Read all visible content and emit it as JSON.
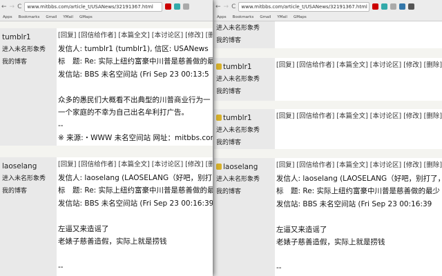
{
  "browser": {
    "url": "www.mitbbs.com/article_t/USANews/32191367.html",
    "bookmarks": [
      "Apps",
      "Bookmarks",
      "Gmail",
      "YMail",
      "GMaps"
    ]
  },
  "actions": "[回复] [回信给作者] [本篇全文] [本讨论区] [修改] [删除]",
  "side": {
    "show": "进入未名形象秀",
    "blog": "我的博客"
  },
  "post1": {
    "author": "tumblr1",
    "from": "发信人: tumblr1 (tumblr1), 信区: USANews",
    "title": "标　题: Re: 实际上纽约富豪中川普是慈善做的最少的",
    "station": "发信站: BBS 未名空间站 (Fri Sep 23 00:13:5",
    "line1": "众多的愚民们大概看不出典型的川普商业行为一",
    "line2": "一个家庭的不幸为自己出名牟利打广告。",
    "sig": "--",
    "source": "※ 来源:・WWW 未名空间站 网址：mitbbs.com"
  },
  "post2": {
    "author": "laoselang",
    "from": "发信人: laoselang (LAOSELANG（好吧，别打了，",
    "title": "标　题: Re: 实际上纽约富豪中川普是慈善做的最少",
    "station": "发信站: BBS 未名空间站 (Fri Sep 23 00:16:39",
    "line1": "左逼又来造谣了",
    "line2": "老婊子慈善造假，实际上就是捞钱",
    "sig": "--"
  },
  "post_tumblr_a": {
    "author": "tumblr1"
  },
  "post_tumblr_b": {
    "author": "tumblr1"
  }
}
